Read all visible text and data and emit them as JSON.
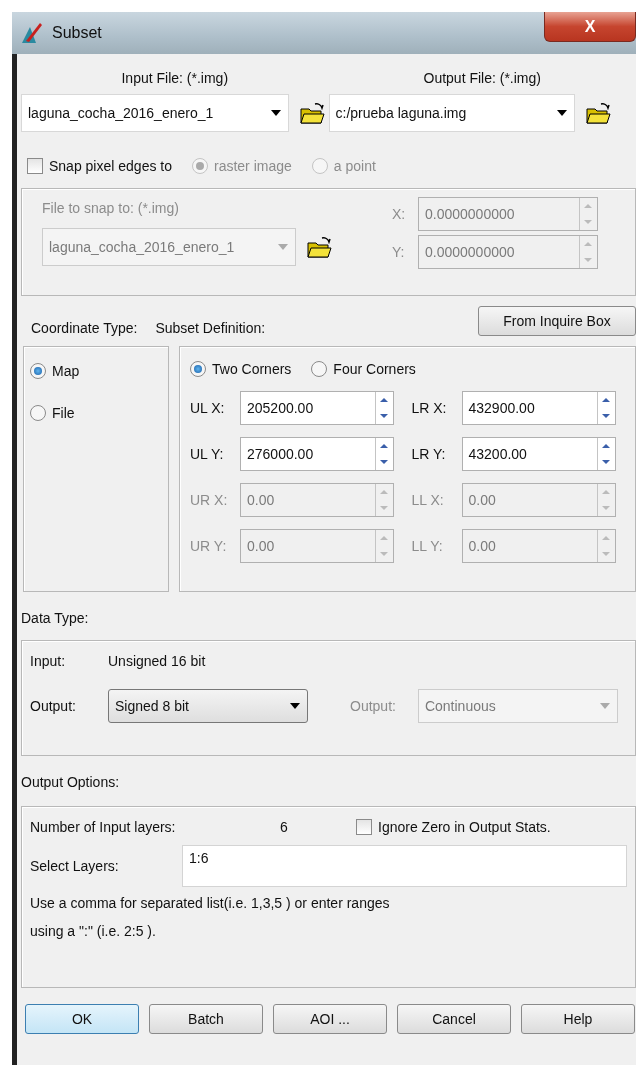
{
  "window": {
    "title": "Subset",
    "close": "X"
  },
  "input_file": {
    "label": "Input File: (*.img)",
    "value": "laguna_cocha_2016_enero_1"
  },
  "output_file": {
    "label": "Output File: (*.img)",
    "value": "c:/prueba laguna.img"
  },
  "snap": {
    "label": "Snap pixel edges to",
    "checked": false,
    "options": [
      {
        "label": "raster image",
        "selected": true
      },
      {
        "label": "a point",
        "selected": false
      }
    ]
  },
  "snap_group": {
    "disabled": true,
    "file_label": "File to snap to: (*.img)",
    "file_value": "laguna_cocha_2016_enero_1",
    "coords": [
      {
        "label": "X:",
        "value": "0.0000000000"
      },
      {
        "label": "Y:",
        "value": "0.0000000000"
      }
    ]
  },
  "coordinate_type": {
    "label": "Coordinate Type:",
    "options": [
      {
        "label": "Map",
        "selected": true
      },
      {
        "label": "File",
        "selected": false
      }
    ]
  },
  "subset_definition": {
    "label": "Subset Definition:",
    "button": "From Inquire Box",
    "modes": [
      {
        "label": "Two Corners",
        "selected": true
      },
      {
        "label": "Four Corners",
        "selected": false
      }
    ],
    "fields": [
      {
        "label": "UL X:",
        "value": "205200.00",
        "disabled": false
      },
      {
        "label": "LR X:",
        "value": "432900.00",
        "disabled": false
      },
      {
        "label": "UL Y:",
        "value": "276000.00",
        "disabled": false
      },
      {
        "label": "LR Y:",
        "value": "43200.00",
        "disabled": false
      },
      {
        "label": "UR X:",
        "value": "0.00",
        "disabled": true
      },
      {
        "label": "LL X:",
        "value": "0.00",
        "disabled": true
      },
      {
        "label": "UR Y:",
        "value": "0.00",
        "disabled": true
      },
      {
        "label": "LL Y:",
        "value": "0.00",
        "disabled": true
      }
    ]
  },
  "data_type": {
    "label": "Data Type:",
    "input_label": "Input:",
    "input_value": "Unsigned 16 bit",
    "output_label": "Output:",
    "output_value": "Signed 8 bit",
    "output2_label": "Output:",
    "output2_value": "Continuous",
    "output2_disabled": true
  },
  "output_options": {
    "label": "Output Options:",
    "layers_label": "Number of Input layers:",
    "layers_count": "6",
    "ignore_zero": {
      "label": "Ignore Zero in Output Stats.",
      "checked": false
    },
    "select_label": "Select Layers:",
    "select_value": "1:6",
    "hint_lines": [
      "Use a comma for separated list(i.e. 1,3,5 ) or enter ranges",
      "using a \":\" (i.e. 2:5 )."
    ]
  },
  "buttons": [
    {
      "label": "OK",
      "default": true
    },
    {
      "label": "Batch",
      "default": false
    },
    {
      "label": "AOI ...",
      "default": false
    },
    {
      "label": "Cancel",
      "default": false
    },
    {
      "label": "Help",
      "default": false
    }
  ]
}
